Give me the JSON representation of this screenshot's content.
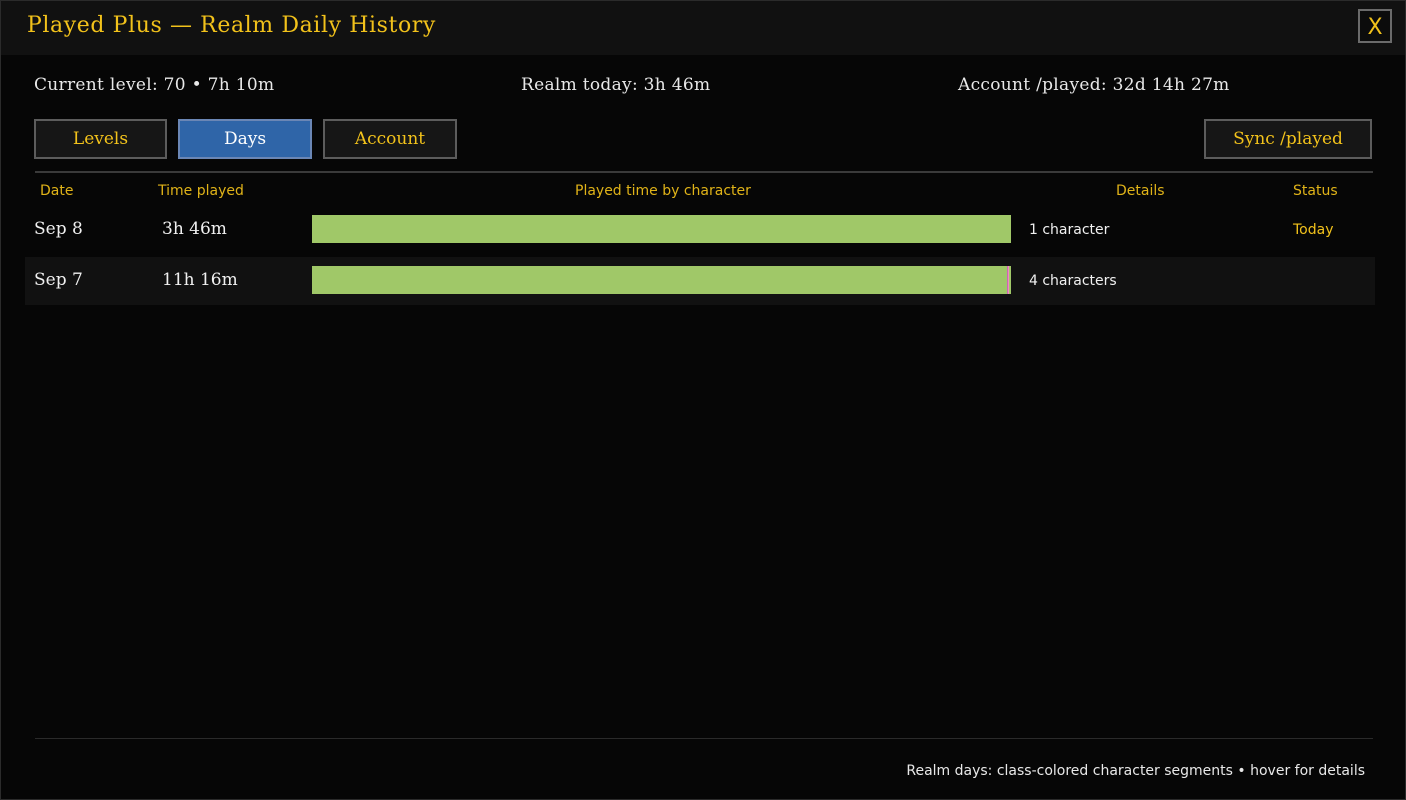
{
  "window": {
    "title": "Played Plus — Realm Daily History",
    "close_label": "X"
  },
  "stats": {
    "current_level": "Current level: 70  •  7h 10m",
    "realm_today": "Realm today: 3h 46m",
    "account_played": "Account /played: 32d 14h 27m"
  },
  "tabs": [
    {
      "label": "Levels",
      "active": false
    },
    {
      "label": "Days",
      "active": true
    },
    {
      "label": "Account",
      "active": false
    }
  ],
  "sync_button": "Sync /played",
  "columns": {
    "date": "Date",
    "time_played": "Time played",
    "bar": "Played time by character",
    "details": "Details",
    "status": "Status"
  },
  "rows": [
    {
      "date": "Sep 8",
      "time": "3h 46m",
      "details": "1 character",
      "status": "Today",
      "segments": [
        {
          "fraction": 1.0,
          "color": "#a0c868"
        }
      ]
    },
    {
      "date": "Sep 7",
      "time": "11h 16m",
      "details": "4 characters",
      "status": "",
      "segments": [
        {
          "fraction": 0.994,
          "color": "#a0c868"
        },
        {
          "fraction": 0.002,
          "color": "#c86ab4"
        },
        {
          "fraction": 0.002,
          "color": "#f48cba"
        },
        {
          "fraction": 0.002,
          "color": "#a0c868"
        }
      ]
    }
  ],
  "footer": "Realm days: class-colored character segments  •  hover for details",
  "colors": {
    "accent": "#f2c21b",
    "active_tab": "#2f65a8",
    "bar_green": "#a0c868"
  }
}
